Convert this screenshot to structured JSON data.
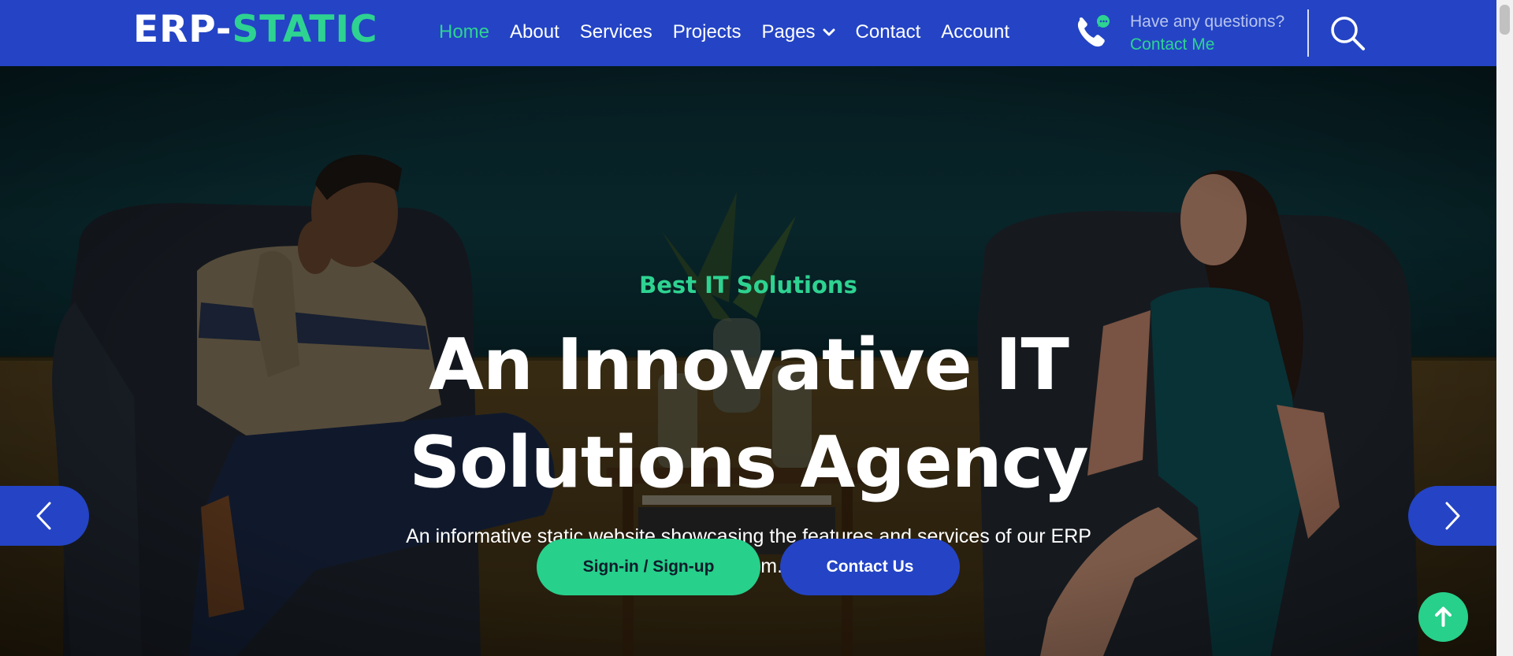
{
  "brand": {
    "main": "ERP-",
    "accent": "STATIC"
  },
  "nav": {
    "items": [
      {
        "label": "Home",
        "active": true
      },
      {
        "label": "About"
      },
      {
        "label": "Services"
      },
      {
        "label": "Projects"
      },
      {
        "label": "Pages"
      },
      {
        "label": "Contact"
      },
      {
        "label": "Account"
      }
    ]
  },
  "contact": {
    "question": "Have any questions?",
    "link": "Contact Me"
  },
  "hero": {
    "kicker": "Best IT Solutions",
    "title": "An Innovative IT Solutions Agency",
    "subtitle": "An informative static website showcasing the features and services of our ERP system.",
    "primary_button": "Sign-in / Sign-up",
    "secondary_button": "Contact Us"
  },
  "icons": {
    "phone": "phone-chat-icon",
    "search": "search-icon",
    "chevron": "chevron-down-icon",
    "prev": "chevron-left-icon",
    "next": "chevron-right-icon",
    "top": "arrow-up-icon"
  },
  "colors": {
    "nav_bg": "#2444c5",
    "accent": "#2ed391",
    "button_green": "#27d08b",
    "text_light": "#ffffff"
  }
}
